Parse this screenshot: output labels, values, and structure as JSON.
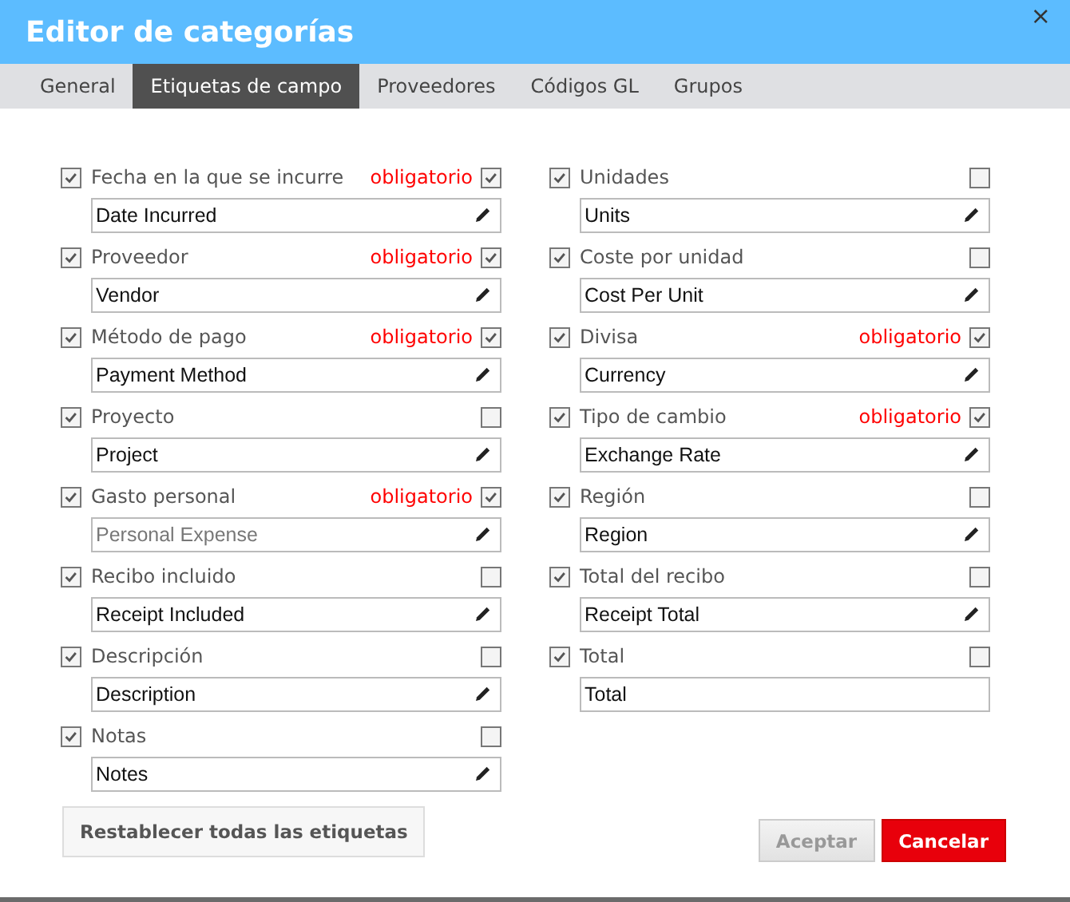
{
  "window": {
    "title": "Editor de categorías",
    "close": "×"
  },
  "tabs": [
    {
      "label": "General",
      "selected": false
    },
    {
      "label": "Etiquetas de campo",
      "selected": true
    },
    {
      "label": "Proveedores",
      "selected": false
    },
    {
      "label": "Códigos GL",
      "selected": false
    },
    {
      "label": "Grupos",
      "selected": false
    }
  ],
  "columns": [
    [
      {
        "label": "Fecha en la que se incurre",
        "checked": true,
        "required": true,
        "required_label": "obligatorio",
        "value": "Date Incurred",
        "editable": true
      },
      {
        "label": "Proveedor",
        "checked": true,
        "required": true,
        "required_label": "obligatorio",
        "value": "Vendor",
        "editable": true
      },
      {
        "label": "Método de pago",
        "checked": true,
        "required": true,
        "required_label": "obligatorio",
        "value": "Payment Method",
        "editable": true
      },
      {
        "label": "Proyecto",
        "checked": true,
        "required": false,
        "value": "Project",
        "editable": true
      },
      {
        "label": "Gasto personal",
        "checked": true,
        "required": true,
        "required_label": "obligatorio",
        "placeholder": "Personal Expense",
        "editable": true
      },
      {
        "label": "Recibo incluido",
        "checked": true,
        "required": false,
        "value": "Receipt Included",
        "editable": true
      },
      {
        "label": "Descripción",
        "checked": true,
        "required": false,
        "value": "Description",
        "editable": true
      },
      {
        "label": "Notas",
        "checked": true,
        "required": false,
        "value": "Notes",
        "editable": true
      }
    ],
    [
      {
        "label": "Unidades",
        "checked": true,
        "required": false,
        "value": "Units",
        "editable": true
      },
      {
        "label": "Coste por unidad",
        "checked": true,
        "required": false,
        "value": "Cost Per Unit",
        "editable": true
      },
      {
        "label": "Divisa",
        "checked": true,
        "required": true,
        "required_label": "obligatorio",
        "value": "Currency",
        "editable": true
      },
      {
        "label": "Tipo de cambio",
        "checked": true,
        "required": true,
        "required_label": "obligatorio",
        "value": "Exchange Rate",
        "editable": true
      },
      {
        "label": "Región",
        "checked": true,
        "required": false,
        "value": "Region",
        "editable": true
      },
      {
        "label": "Total del recibo",
        "checked": true,
        "required": false,
        "value": "Receipt Total",
        "editable": true
      },
      {
        "label": "Total",
        "checked": true,
        "required": false,
        "value": "Total",
        "editable": false
      }
    ]
  ],
  "reset_button": {
    "label": "Restablecer todas las etiquetas"
  },
  "buttons": [
    {
      "label": "Aceptar",
      "kind": "secondary",
      "disabled": true
    },
    {
      "label": "Cancelar",
      "kind": "primary",
      "disabled": false
    }
  ]
}
